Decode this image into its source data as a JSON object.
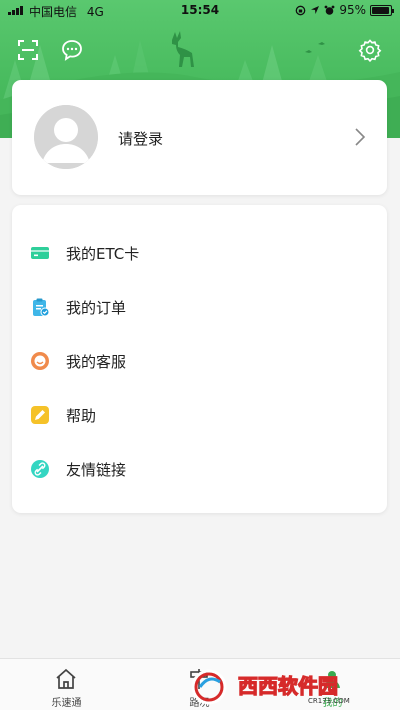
{
  "status_bar": {
    "carrier": "中国电信",
    "network": "4G",
    "time": "15:54",
    "battery": "95%"
  },
  "header": {
    "icons": [
      "scan-icon",
      "message-icon",
      "settings-icon"
    ],
    "color": "#4cbf62"
  },
  "login": {
    "label": "请登录"
  },
  "menu": {
    "items": [
      {
        "label": "我的ETC卡",
        "icon": "card-icon",
        "color": "#2ecf9a"
      },
      {
        "label": "我的订单",
        "icon": "clipboard-icon",
        "color": "#3fb6e8"
      },
      {
        "label": "我的客服",
        "icon": "service-icon",
        "color": "#f08a4b"
      },
      {
        "label": "帮助",
        "icon": "pencil-icon",
        "color": "#f5c229"
      },
      {
        "label": "友情链接",
        "icon": "link-icon",
        "color": "#34d6c2"
      }
    ]
  },
  "tabbar": {
    "tabs": [
      {
        "label": "乐速通",
        "icon": "home-icon"
      },
      {
        "label": "路况",
        "icon": "road-icon"
      },
      {
        "label": "我的",
        "icon": "profile-icon",
        "active": true
      }
    ]
  },
  "watermark": {
    "text": "西西软件园",
    "sub": "CR173.COM"
  }
}
